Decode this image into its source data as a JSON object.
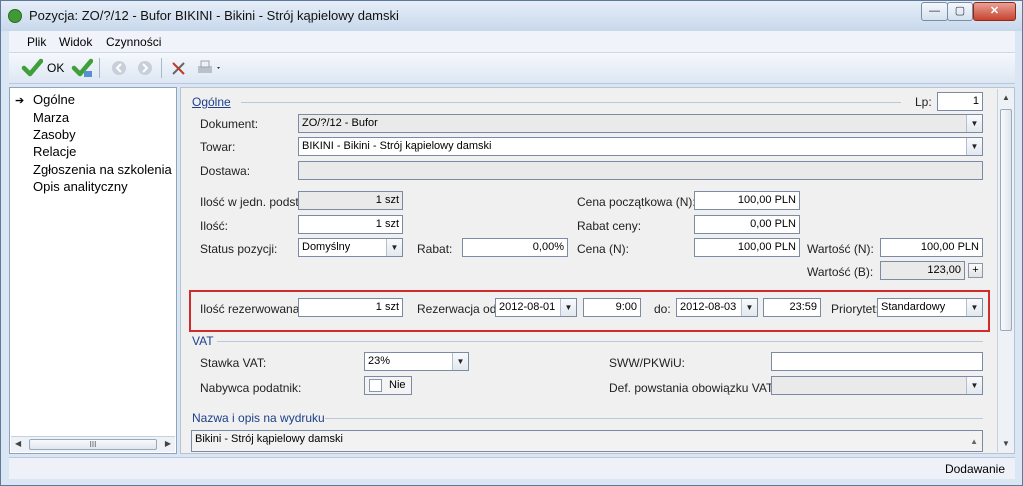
{
  "window": {
    "title": "Pozycja: ZO/?/12 - Bufor BIKINI - Bikini - Strój kąpielowy damski",
    "buttons": {
      "minimize": "—",
      "maximize": "▢",
      "close": "✕"
    }
  },
  "menu": {
    "items": [
      "Plik",
      "Widok",
      "Czynności"
    ]
  },
  "toolbar": {
    "ok_label": "OK"
  },
  "sidebar": {
    "items": [
      {
        "label": "Ogólne",
        "selected": true
      },
      {
        "label": "Marza"
      },
      {
        "label": "Zasoby"
      },
      {
        "label": "Relacje"
      },
      {
        "label": "Zgłoszenia na szkolenia"
      },
      {
        "label": "Opis analityczny"
      }
    ],
    "scroll_grip": "III"
  },
  "general": {
    "section_title": "Ogólne",
    "lp_label": "Lp:",
    "lp_value": "1",
    "dokument_label": "Dokument:",
    "dokument_value": "ZO/?/12 - Bufor",
    "towar_label": "Towar:",
    "towar_value": "BIKINI - Bikini - Strój kąpielowy damski",
    "dostawa_label": "Dostawa:",
    "dostawa_value": "",
    "ilosc_jedn_label": "Ilość w jedn. podst.:",
    "ilosc_jedn_value": "1 szt",
    "ilosc_label": "Ilość:",
    "ilosc_value": "1 szt",
    "status_label": "Status pozycji:",
    "status_value": "Domyślny",
    "rabat_label": "Rabat:",
    "rabat_value": "0,00%",
    "cena_pocz_label": "Cena początkowa (N):",
    "cena_pocz_value": "100,00 PLN",
    "rabat_ceny_label": "Rabat ceny:",
    "rabat_ceny_value": "0,00 PLN",
    "cena_label": "Cena (N):",
    "cena_value": "100,00 PLN",
    "wartosc_n_label": "Wartość (N):",
    "wartosc_n_value": "100,00 PLN",
    "wartosc_b_label": "Wartość (B):",
    "wartosc_b_value": "123,00",
    "plus": "+"
  },
  "reservation": {
    "ilosc_rez_label": "Ilość rezerwowana:",
    "ilosc_rez_value": "1 szt",
    "od_label": "Rezerwacja od:",
    "od_date": "2012-08-01",
    "od_time": "9:00",
    "do_label": "do:",
    "do_date": "2012-08-03",
    "do_time": "23:59",
    "priorytet_label": "Priorytet:",
    "priorytet_value": "Standardowy"
  },
  "vat": {
    "section_title": "VAT",
    "stawka_label": "Stawka VAT:",
    "stawka_value": "23%",
    "sww_label": "SWW/PKWiU:",
    "sww_value": "",
    "nabywca_label": "Nabywca podatnik:",
    "nabywca_value": "Nie",
    "def_label": "Def. powstania obowiązku VAT:",
    "def_value": ""
  },
  "print": {
    "section_title": "Nazwa i opis na wydruku",
    "name_value": "Bikini - Strój kąpielowy damski"
  },
  "status": {
    "text": "Dodawanie"
  },
  "colors": {
    "accent": "#1e3f8a",
    "highlight_border": "#d22b2b",
    "ok_check": "#3fa03a"
  }
}
